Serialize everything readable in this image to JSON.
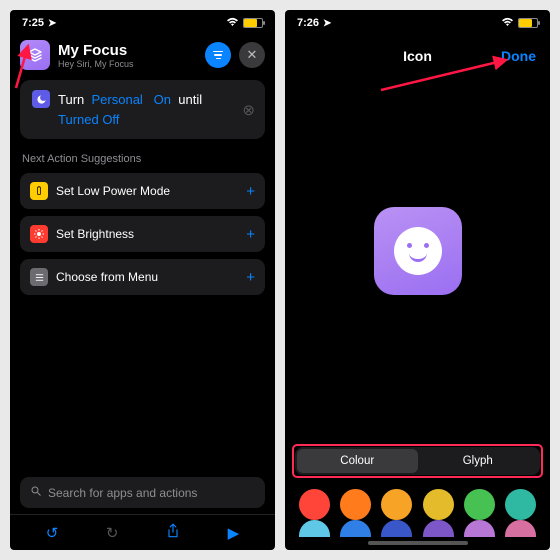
{
  "status": {
    "time_left": "7:25",
    "time_right": "7:26"
  },
  "left": {
    "title": "My Focus",
    "subtitle": "Hey Siri, My Focus",
    "action": {
      "w1": "Turn",
      "w2": "Personal",
      "w3": "On",
      "w4": "until",
      "w5": "Turned Off"
    },
    "suggestions_label": "Next Action Suggestions",
    "s1": "Set Low Power Mode",
    "s2": "Set Brightness",
    "s3": "Choose from Menu",
    "search_placeholder": "Search for apps and actions"
  },
  "right": {
    "nav_title": "Icon",
    "done": "Done",
    "seg_colour": "Colour",
    "seg_glyph": "Glyph",
    "palette_row1": [
      "#ff3b30",
      "#ff9500",
      "#ffcc00",
      "#34c759",
      "#30d158",
      "#64d2ff"
    ],
    "palette_row2": [
      "#0a84ff",
      "#5856d6",
      "#af52de",
      "#ff2d92",
      "#8e8e93",
      "#a2845e"
    ]
  }
}
